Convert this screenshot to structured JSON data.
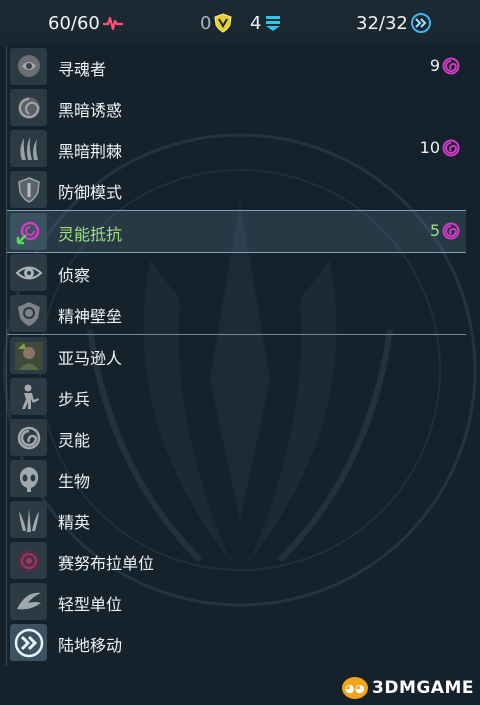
{
  "topbar": {
    "health": "60/60",
    "armor": "0",
    "shield": "4",
    "energy": "32/32"
  },
  "rows": [
    {
      "label": "寻魂者",
      "cost": "9",
      "icon": "ghost-face-icon"
    },
    {
      "label": "黑暗诱惑",
      "cost": "",
      "icon": "swirl-face-icon"
    },
    {
      "label": "黑暗荆棘",
      "cost": "10",
      "icon": "flame-claws-icon"
    },
    {
      "label": "防御模式",
      "cost": "",
      "icon": "shield-emblem-icon"
    },
    {
      "label": "灵能抵抗",
      "cost": "5",
      "icon": "psionic-arrow-icon"
    },
    {
      "label": "侦察",
      "cost": "",
      "icon": "eye-icon"
    },
    {
      "label": "精神壁垒",
      "cost": "",
      "icon": "mind-barrier-icon"
    },
    {
      "label": "亚马逊人",
      "cost": "",
      "icon": "amazon-portrait-icon"
    },
    {
      "label": "步兵",
      "cost": "",
      "icon": "infantry-icon"
    },
    {
      "label": "灵能",
      "cost": "",
      "icon": "psionic-icon"
    },
    {
      "label": "生物",
      "cost": "",
      "icon": "biological-icon"
    },
    {
      "label": "精英",
      "cost": "",
      "icon": "elite-icon"
    },
    {
      "label": "赛努布拉单位",
      "cost": "",
      "icon": "sainubra-unit-icon"
    },
    {
      "label": "轻型单位",
      "cost": "",
      "icon": "light-unit-icon"
    },
    {
      "label": "陆地移动",
      "cost": "",
      "icon": "ground-movement-icon"
    }
  ],
  "watermark": "3DMGAME"
}
